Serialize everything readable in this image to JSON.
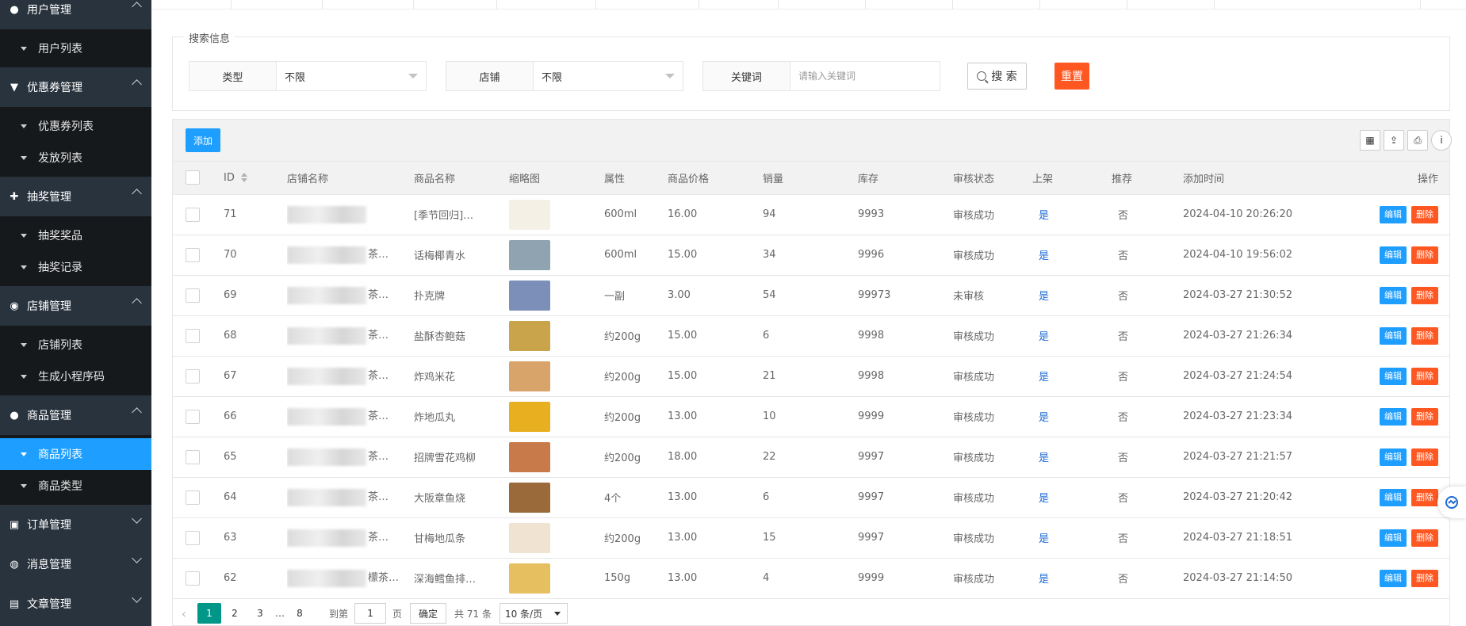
{
  "sidebar": {
    "groups": [
      {
        "label": "用户管理",
        "icon": "user-icon",
        "expanded": true,
        "items": [
          "用户列表"
        ]
      },
      {
        "label": "优惠券管理",
        "icon": "filter-icon",
        "expanded": true,
        "items": [
          "优惠券列表",
          "发放列表"
        ]
      },
      {
        "label": "抽奖管理",
        "icon": "gift-icon",
        "expanded": true,
        "items": [
          "抽奖奖品",
          "抽奖记录"
        ]
      },
      {
        "label": "店铺管理",
        "icon": "user-plus-icon",
        "expanded": true,
        "items": [
          "店铺列表",
          "生成小程序码"
        ]
      },
      {
        "label": "商品管理",
        "icon": "apple-icon",
        "expanded": true,
        "items": [
          "商品列表",
          "商品类型"
        ],
        "active_item": "商品列表"
      },
      {
        "label": "订单管理",
        "icon": "cart-icon",
        "expanded": false,
        "items": []
      },
      {
        "label": "消息管理",
        "icon": "chat-icon",
        "expanded": false,
        "items": []
      },
      {
        "label": "文章管理",
        "icon": "doc-icon",
        "expanded": false,
        "items": []
      }
    ]
  },
  "search": {
    "legend": "搜索信息",
    "type_label": "类型",
    "type_value": "不限",
    "shop_label": "店铺",
    "shop_value": "不限",
    "keyword_label": "关键词",
    "keyword_placeholder": "请输入关键词",
    "search_button": "搜 索",
    "reset_button": "重置"
  },
  "toolbar": {
    "add_button": "添加",
    "icons": [
      "columns-icon",
      "export-icon",
      "print-icon",
      "info-icon"
    ]
  },
  "table": {
    "columns": [
      "ID",
      "店铺名称",
      "商品名称",
      "缩略图",
      "属性",
      "商品价格",
      "销量",
      "库存",
      "审核状态",
      "上架",
      "推荐",
      "添加时间",
      "操作"
    ],
    "edit_label": "编辑",
    "delete_label": "删除",
    "rows": [
      {
        "id": "71",
        "shop": "",
        "name": "[季节回归]…",
        "attr": "600ml",
        "price": "16.00",
        "sales": "94",
        "stock": "9993",
        "status": "审核成功",
        "onshelf": "是",
        "recommend": "否",
        "time": "2024-04-10 20:26:20",
        "thumb": "#f4f0e6"
      },
      {
        "id": "70",
        "shop": "茶…",
        "name": "话梅椰青水",
        "attr": "600ml",
        "price": "15.00",
        "sales": "34",
        "stock": "9996",
        "status": "审核成功",
        "onshelf": "是",
        "recommend": "否",
        "time": "2024-04-10 19:56:02",
        "thumb": "#8fa3b0"
      },
      {
        "id": "69",
        "shop": "茶…",
        "name": "扑克牌",
        "attr": "一副",
        "price": "3.00",
        "sales": "54",
        "stock": "99973",
        "status": "未审核",
        "onshelf": "是",
        "recommend": "否",
        "time": "2024-03-27 21:30:52",
        "thumb": "#7b8fb8"
      },
      {
        "id": "68",
        "shop": "茶…",
        "name": "盐酥杏鲍菇",
        "attr": "约200g",
        "price": "15.00",
        "sales": "6",
        "stock": "9998",
        "status": "审核成功",
        "onshelf": "是",
        "recommend": "否",
        "time": "2024-03-27 21:26:34",
        "thumb": "#c9a44a"
      },
      {
        "id": "67",
        "shop": "茶…",
        "name": "炸鸡米花",
        "attr": "约200g",
        "price": "15.00",
        "sales": "21",
        "stock": "9998",
        "status": "审核成功",
        "onshelf": "是",
        "recommend": "否",
        "time": "2024-03-27 21:24:54",
        "thumb": "#d9a46a"
      },
      {
        "id": "66",
        "shop": "茶…",
        "name": "炸地瓜丸",
        "attr": "约200g",
        "price": "13.00",
        "sales": "10",
        "stock": "9999",
        "status": "审核成功",
        "onshelf": "是",
        "recommend": "否",
        "time": "2024-03-27 21:23:34",
        "thumb": "#e8b020"
      },
      {
        "id": "65",
        "shop": "茶…",
        "name": "招牌雪花鸡柳",
        "attr": "约200g",
        "price": "18.00",
        "sales": "22",
        "stock": "9997",
        "status": "审核成功",
        "onshelf": "是",
        "recommend": "否",
        "time": "2024-03-27 21:21:57",
        "thumb": "#c87a4a"
      },
      {
        "id": "64",
        "shop": "茶…",
        "name": "大阪章鱼烧",
        "attr": "4个",
        "price": "13.00",
        "sales": "6",
        "stock": "9997",
        "status": "审核成功",
        "onshelf": "是",
        "recommend": "否",
        "time": "2024-03-27 21:20:42",
        "thumb": "#9a6a3a"
      },
      {
        "id": "63",
        "shop": "茶…",
        "name": "甘梅地瓜条",
        "attr": "约200g",
        "price": "13.00",
        "sales": "15",
        "stock": "9997",
        "status": "审核成功",
        "onshelf": "是",
        "recommend": "否",
        "time": "2024-03-27 21:18:51",
        "thumb": "#f1e3d2"
      },
      {
        "id": "62",
        "shop": "檬茶…",
        "name": "深海鳕鱼排…",
        "attr": "150g",
        "price": "13.00",
        "sales": "4",
        "stock": "9999",
        "status": "审核成功",
        "onshelf": "是",
        "recommend": "否",
        "time": "2024-03-27 21:14:50",
        "thumb": "#e6c060"
      }
    ]
  },
  "pager": {
    "pages": [
      "1",
      "2",
      "3",
      "…",
      "8"
    ],
    "active": "1",
    "goto_label": "到第",
    "goto_value": "1",
    "page_unit": "页",
    "confirm": "确定",
    "total": "共 71 条",
    "per_page": "10 条/页"
  },
  "colors": {
    "sidebar_bg": "#28333e",
    "sidebar_sub_bg": "#16191c",
    "active": "#1e9fff",
    "danger": "#ff5722",
    "pager_active": "#009688"
  }
}
